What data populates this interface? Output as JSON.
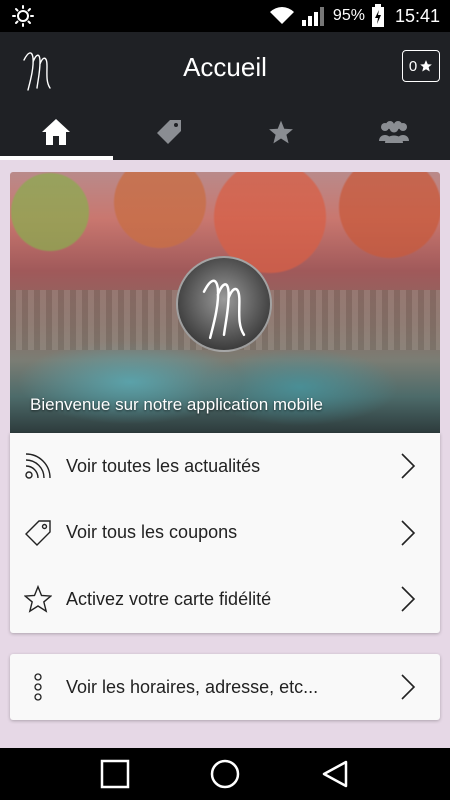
{
  "status_bar": {
    "battery": "95%",
    "time": "15:41"
  },
  "header": {
    "title": "Accueil",
    "star_count": "0"
  },
  "tabs": [
    {
      "icon": "home-icon",
      "active": true
    },
    {
      "icon": "tag-icon",
      "active": false
    },
    {
      "icon": "star-icon",
      "active": false
    },
    {
      "icon": "group-icon",
      "active": false
    }
  ],
  "hero": {
    "caption": "Bienvenue sur notre application mobile"
  },
  "menu": {
    "items": [
      {
        "label": "Voir toutes les actualités",
        "icon": "rss-icon"
      },
      {
        "label": "Voir tous les coupons",
        "icon": "tag-icon"
      },
      {
        "label": "Activez votre carte fidélité",
        "icon": "star-icon"
      }
    ]
  },
  "info": {
    "label": "Voir les horaires, adresse, etc...",
    "icon": "more-dots-icon"
  },
  "colors": {
    "header_bg": "#1f2125",
    "page_bg": "#e6d8e6",
    "card_bg": "#f9f9f9"
  }
}
